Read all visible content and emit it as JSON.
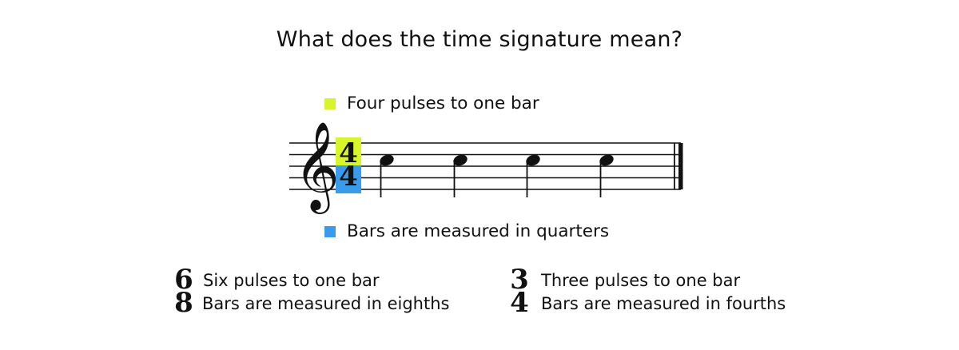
{
  "title": "What does the time signature mean?",
  "legend": {
    "top": {
      "label": "Four pulses to one bar",
      "color": "#d8f52a"
    },
    "bottom": {
      "label": "Bars are measured in quarters",
      "color": "#3a9bea"
    }
  },
  "staff": {
    "clef": "treble-clef-icon",
    "time_signature": {
      "top": "4",
      "bottom": "4"
    },
    "notes": [
      "quarter",
      "quarter",
      "quarter",
      "quarter"
    ],
    "barline": "final"
  },
  "examples": [
    {
      "time_signature": {
        "top": "6",
        "bottom": "8"
      },
      "line1": "Six pulses to one bar",
      "line2": "Bars are measured in eighths"
    },
    {
      "time_signature": {
        "top": "3",
        "bottom": "4"
      },
      "line1": "Three pulses to one bar",
      "line2": "Bars are measured in fourths"
    }
  ]
}
